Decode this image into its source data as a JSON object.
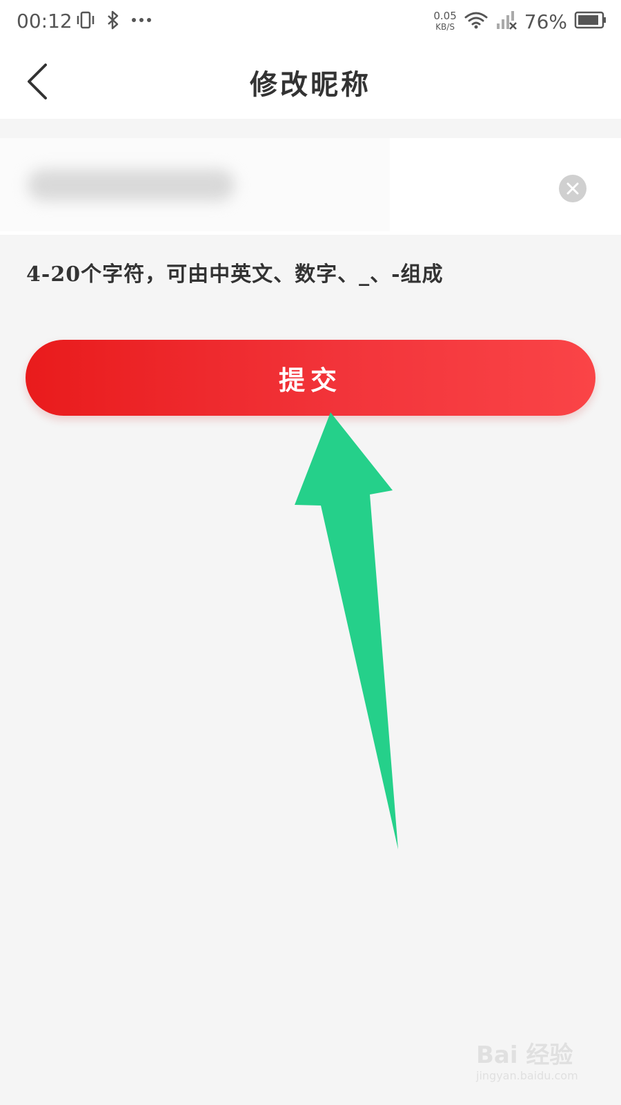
{
  "status_bar": {
    "time": "00:12",
    "net_speed_value": "0.05",
    "net_speed_unit": "KB/S",
    "battery_percent": "76%",
    "icons": [
      "vibrate-icon",
      "bluetooth-icon",
      "more-dots-icon",
      "wifi-icon",
      "signal-icon",
      "battery-icon"
    ]
  },
  "header": {
    "title": "修改昵称",
    "back_icon": "chevron-left-icon"
  },
  "nickname": {
    "value": "",
    "placeholder": "",
    "clear_icon": "close-circle-icon"
  },
  "hint": "4-20个字符，可由中英文、数字、_、-组成",
  "submit": {
    "label": "提交"
  },
  "annotation": {
    "type": "arrow",
    "color": "#25d08a"
  },
  "watermark": {
    "main": "Bai 经验",
    "sub": "jingyan.baidu.com"
  },
  "colors": {
    "accent_start": "#e91b1c",
    "accent_end": "#fa4447",
    "background": "#f5f5f5",
    "surface": "#ffffff"
  }
}
